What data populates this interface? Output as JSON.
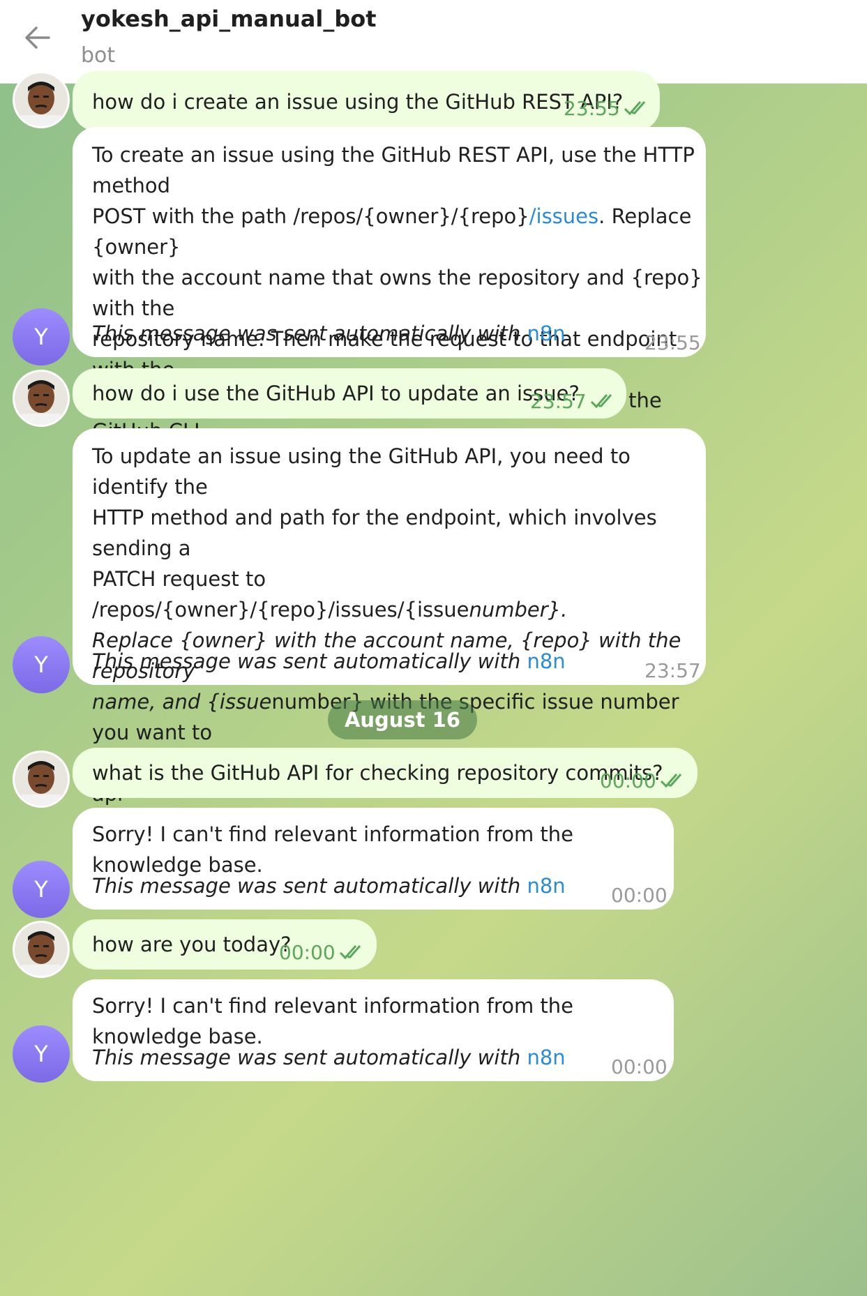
{
  "header": {
    "title": "yokesh_api_manual_bot",
    "subtitle": "bot"
  },
  "bot_avatar_letter": "Y",
  "date_separator": "August 16",
  "messages": [
    {
      "type": "out",
      "text": "how do i create an issue using the GitHub REST API?",
      "time": "23:55"
    },
    {
      "type": "in",
      "text_parts": [
        "To create an issue using the GitHub REST API, use the HTTP method\nPOST with the path /repos/{owner}/{repo}",
        "/issues",
        ". Replace {owner}\nwith the account name that owns the repository and {repo} with the\nrepository name. Then make the request to that endpoint with the\nnecessary data to create the issue. You can also use the GitHub CLI\napi subcommand for making your API request."
      ],
      "footer": "This message was sent automatically with ",
      "footer_link": "n8n",
      "time": "23:55"
    },
    {
      "type": "out",
      "text": "how do i use the GitHub API to update an issue?",
      "time": "23:57"
    },
    {
      "type": "in",
      "text_parts": [
        "To update an issue using the GitHub API, you need to identify the\nHTTP method and path for the endpoint, which involves sending a\nPATCH request to /repos/{owner}/{repo}/issues/{issue",
        "number}.\nReplace {owner} with the account name, {repo} with the repository\nname, and {issue",
        "number} with the specific issue number you want to\nupdate. You can make this request using the GitHub CLI's api\nsubcommand or directly via HTTP."
      ],
      "footer": "This message was sent automatically with ",
      "footer_link": "n8n",
      "time": "23:57"
    },
    {
      "type": "out",
      "text": "what is the GitHub API for checking repository commits?",
      "time": "00:00"
    },
    {
      "type": "in",
      "text": "Sorry! I can't find relevant information from the knowledge base.",
      "footer": "This message was sent automatically with ",
      "footer_link": "n8n",
      "time": "00:00"
    },
    {
      "type": "out",
      "text": "how are you today?",
      "time": "00:00"
    },
    {
      "type": "in",
      "text": "Sorry! I can't find relevant information from the knowledge base.",
      "footer": "This message was sent automatically with ",
      "footer_link": "n8n",
      "time": "00:00"
    }
  ]
}
